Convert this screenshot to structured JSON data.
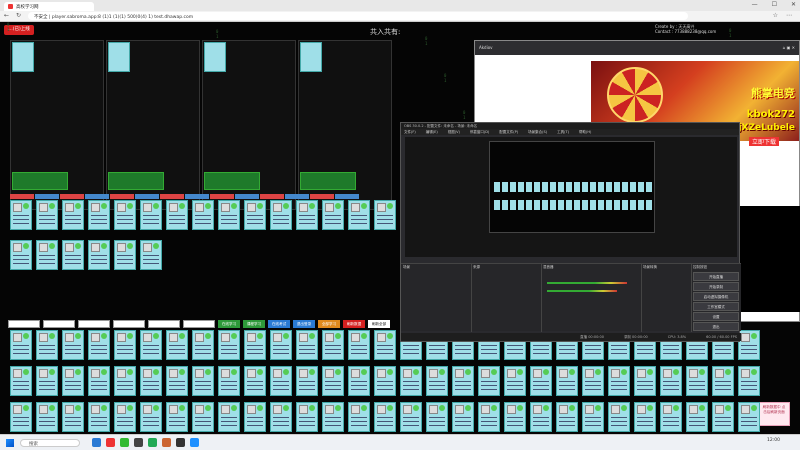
{
  "browser": {
    "tab_title": "高校学习网",
    "url": "不安全 | player.sabroma.app:8 (1)1 (1)(1) 500)0(4) 1) test.dhawap.com",
    "window_controls": [
      "—",
      "☐",
      "✕"
    ]
  },
  "page": {
    "red_button": "…(已)上线",
    "center_title": "共入共有:",
    "info_lines": [
      "Create by : 天天高兴",
      "Contact : 773888238@qq.com"
    ],
    "filter_buttons": [
      {
        "label": "在线学习",
        "color": "#2e9a3a"
      },
      {
        "label": "课程学习",
        "color": "#2e9a3a"
      },
      {
        "label": "在线考试",
        "color": "#2a7ad4"
      },
      {
        "label": "退出登录",
        "color": "#2a7ad4"
      },
      {
        "label": "全部学习",
        "color": "#e08a1e"
      },
      {
        "label": "刷新数据",
        "color": "#d42020"
      },
      {
        "label": "刷新全部",
        "color": "#ffffff"
      }
    ],
    "footer_note": "刷新数据中 点击后刷新页面"
  },
  "sub_window": {
    "title": "Akdiov",
    "ad_title": "熊掌电竞",
    "ad_line1": "kbok272",
    "ad_line2": "VjXZeLubele",
    "ad_cta": "立即下载"
  },
  "obs": {
    "title": "OBS 30.0.2 - 配置文件: 未命名 - 场景: 未命名",
    "menu": [
      "文件(F)",
      "编辑(E)",
      "视图(V)",
      "停靠窗口(D)",
      "配置文件(P)",
      "场景集合(S)",
      "工具(T)",
      "帮助(H)"
    ],
    "docks": [
      "场景",
      "来源",
      "混音器",
      "场景转换",
      "控制按钮"
    ],
    "status": [
      "直播 00:00:00",
      "录制 00:00:00",
      "CPU: 3.8%",
      "60.00 / 60.00 FPS"
    ],
    "controls": [
      "开始直播",
      "开始录制",
      "启动虚拟摄像机",
      "工作室模式",
      "设置",
      "退出"
    ]
  },
  "taskbar": {
    "search_placeholder": "搜索",
    "clock": "12:00"
  }
}
